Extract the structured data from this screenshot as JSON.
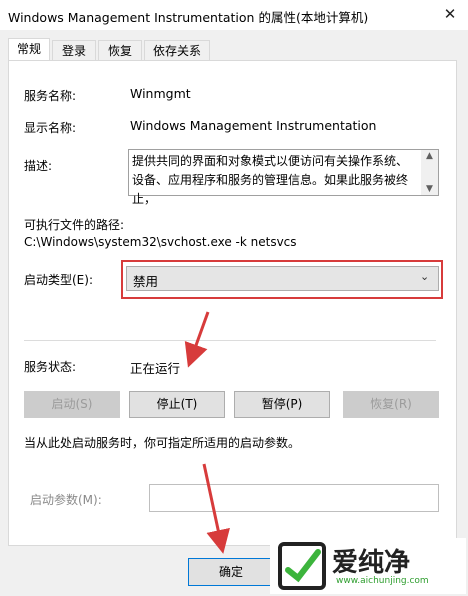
{
  "window": {
    "title": "Windows Management Instrumentation 的属性(本地计算机)",
    "close_glyph": "✕"
  },
  "tabs": [
    {
      "label": "常规",
      "active": true
    },
    {
      "label": "登录",
      "active": false
    },
    {
      "label": "恢复",
      "active": false
    },
    {
      "label": "依存关系",
      "active": false
    }
  ],
  "general": {
    "service_name_label": "服务名称:",
    "service_name": "Winmgmt",
    "display_name_label": "显示名称:",
    "display_name": "Windows Management Instrumentation",
    "description_label": "描述:",
    "description": "提供共同的界面和对象模式以便访问有关操作系统、设备、应用程序和服务的管理信息。如果此服务被终止，",
    "exe_path_label": "可执行文件的路径:",
    "exe_path": "C:\\Windows\\system32\\svchost.exe -k netsvcs",
    "startup_type_label": "启动类型(E):",
    "startup_type_value": "禁用",
    "status_label": "服务状态:",
    "status_value": "正在运行",
    "buttons": {
      "start": "启动(S)",
      "stop": "停止(T)",
      "pause": "暂停(P)",
      "resume": "恢复(R)"
    },
    "start_params_hint": "当从此处启动服务时，你可指定所适用的启动参数。",
    "start_params_label": "启动参数(M):",
    "start_params_value": ""
  },
  "footer": {
    "ok_label": "确定"
  },
  "watermark": {
    "brand": "爱纯净",
    "url": "www.aichunjing.com"
  },
  "colors": {
    "highlight_red": "#d73b3b",
    "focus_blue": "#0078d7"
  }
}
